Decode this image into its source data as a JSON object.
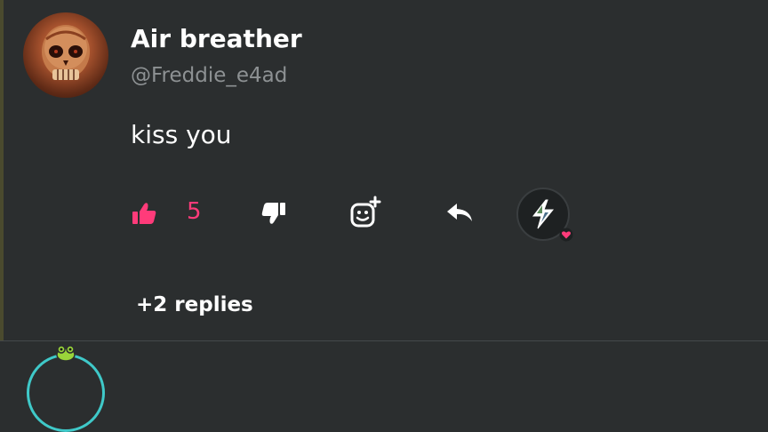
{
  "comment": {
    "author": {
      "display_name": "Air breather",
      "handle": "@Freddie_e4ad",
      "avatar": "skull-avatar"
    },
    "text": "kiss you",
    "actions": {
      "like_icon": "thumbs-up-icon",
      "like_count": "5",
      "dislike_icon": "thumbs-down-icon",
      "react_icon": "add-reaction-icon",
      "reply_icon": "reply-arrow-icon",
      "boost_icon": "lightning-bolt-icon"
    },
    "replies_label": "+2 replies"
  },
  "colors": {
    "background": "#2b2e2f",
    "accent": "#ff3b7a",
    "muted_text": "#8d9193",
    "divider": "#45494b"
  }
}
